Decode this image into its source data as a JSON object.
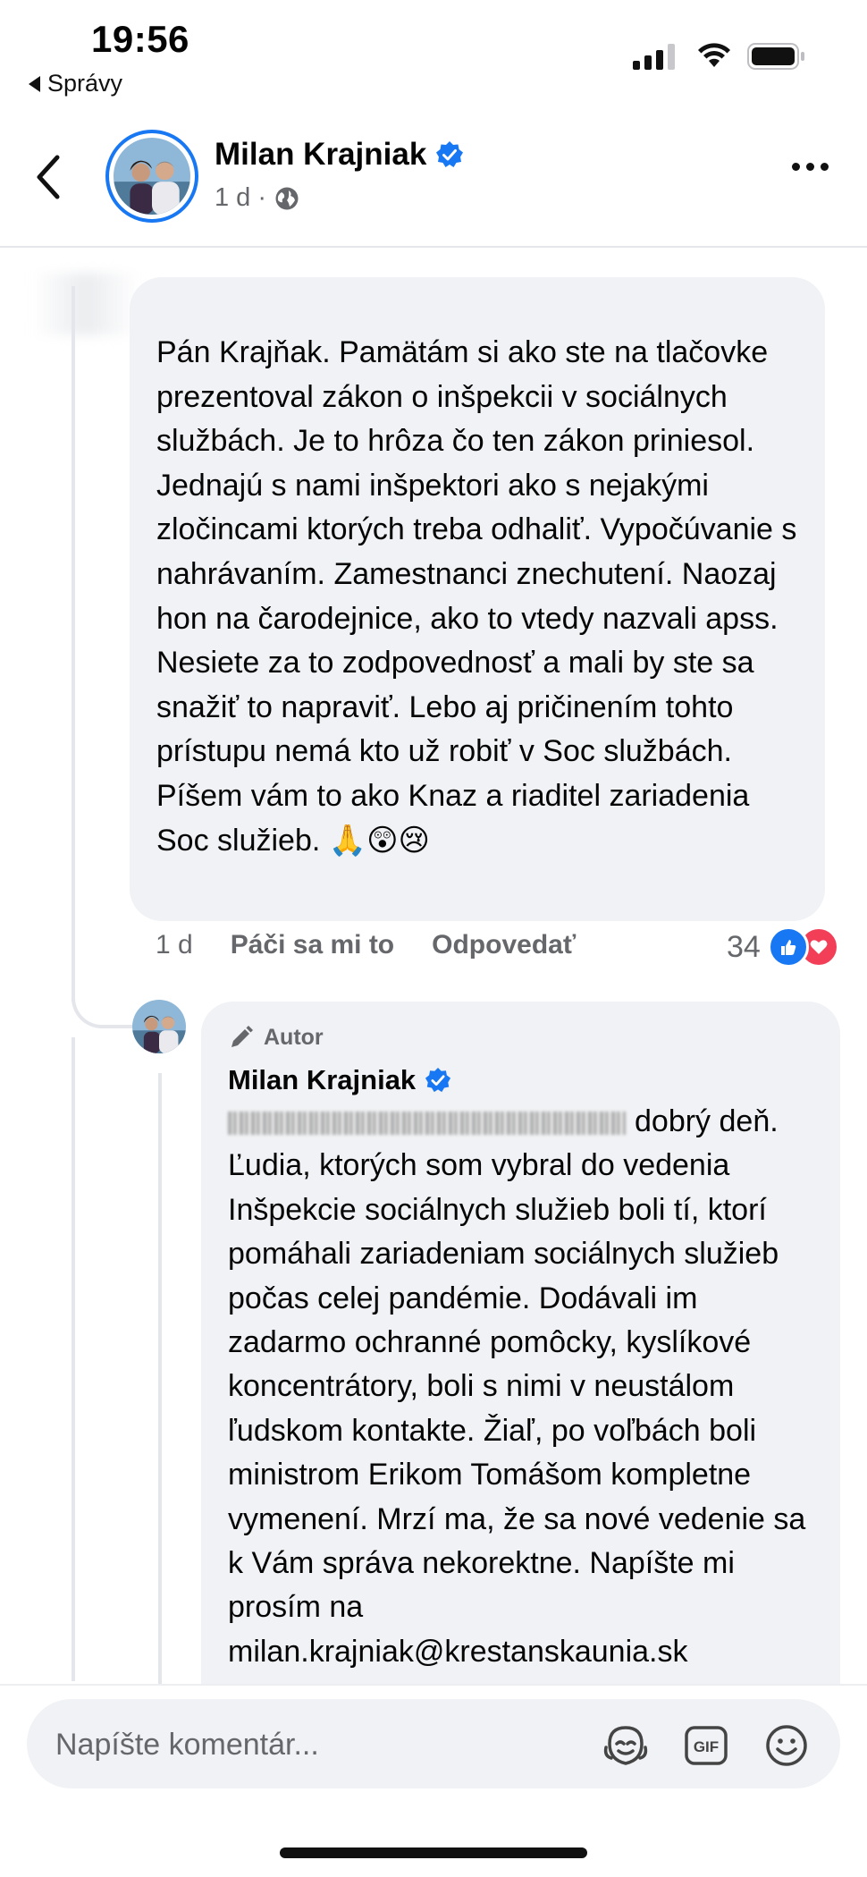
{
  "status_bar": {
    "time": "19:56",
    "back_label": "Správy"
  },
  "header": {
    "name": "Milan Krajniak",
    "meta": "1 d ·",
    "icons": [
      "back-arrow-icon",
      "verified-badge-icon",
      "globe-icon",
      "more-icon"
    ]
  },
  "comment": {
    "text": "Pán Krajňak. Pamätám si ako ste na tlačovke prezentoval zákon o inšpekcii v sociálnych službách. Je to hrôza čo ten zákon priniesol. Jednajú s nami inšpektori ako s nejakými zločincami ktorých treba odhaliť. Vypočúvanie s nahrávaním. Zamestnanci znechutení. Naozaj hon na čarodejnice, ako to vtedy nazvali apss. Nesiete za to zodpovednosť a mali by ste sa snažiť to napraviť. Lebo aj pričinením tohto prístupu nemá kto už robiť v Soc službách. Píšem vám to ako Knaz a riaditel zariadenia Soc služieb.",
    "emojis": "🙏😲😢",
    "time": "1 d",
    "like_label": "Páči sa mi to",
    "reply_label": "Odpovedať",
    "reaction_count": "34",
    "reactions": [
      "like",
      "love"
    ]
  },
  "reply": {
    "author_tag": "Autor",
    "name": "Milan Krajniak",
    "greeting": "dobrý deň.",
    "text": "Ľudia, ktorých som vybral do vedenia Inšpekcie sociálnych služieb boli tí, ktorí pomáhali zariadeniam sociálnych služieb počas celej pandémie. Dodávali im zadarmo ochranné pomôcky, kyslíkové koncentrátory, boli s nimi v neustálom ľudskom kontakte. Žiaľ, po voľbách boli ministrom Erikom Tomášom kompletne vymenení. Mrzí ma, že sa nové vedenie sa k Vám správa nekorektne. Napíšte mi prosím na milan.krajniak@krestanskaunia.sk"
  },
  "composer": {
    "placeholder": "Napíšte komentár...",
    "icons": [
      "avatar-sticker-icon",
      "gif-icon",
      "emoji-icon"
    ]
  },
  "colors": {
    "accent": "#1877f2",
    "bubble": "#f0f2f5",
    "secondary_text": "#65676b",
    "love": "#f33e58"
  }
}
